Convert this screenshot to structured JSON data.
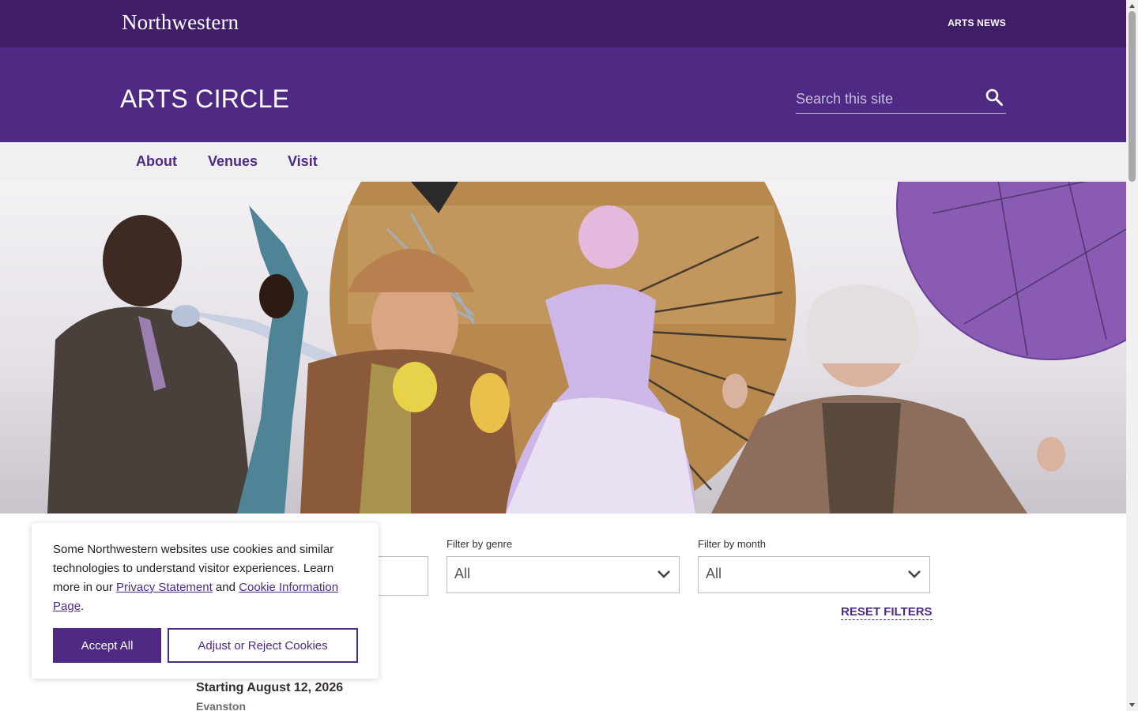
{
  "topbar": {
    "logo": "Northwestern",
    "link": "ARTS NEWS"
  },
  "header": {
    "title": "ARTS CIRCLE",
    "search_placeholder": "Search this site"
  },
  "nav": {
    "items": [
      "About",
      "Venues",
      "Visit"
    ]
  },
  "filters": {
    "genre": {
      "label": "Filter by genre",
      "value": "All"
    },
    "month": {
      "label": "Filter by month",
      "value": "All"
    },
    "reset": "RESET FILTERS"
  },
  "event": {
    "date": "Starting August 12, 2026",
    "location": "Evanston"
  },
  "cookie": {
    "text_1": "Some Northwestern websites use cookies and similar technologies to understand visitor experiences. Learn more in our ",
    "privacy_link": "Privacy Statement",
    "text_2": " and ",
    "cookie_link": "Cookie Information Page",
    "text_3": ".",
    "accept": "Accept All",
    "adjust": "Adjust or Reject Cookies"
  },
  "colors": {
    "primary_purple": "#4e2a84",
    "dark_purple": "#401f68",
    "nav_bg": "#f0f0f0"
  },
  "icons": {
    "search": "search-icon",
    "chevron": "chevron-down-icon"
  }
}
